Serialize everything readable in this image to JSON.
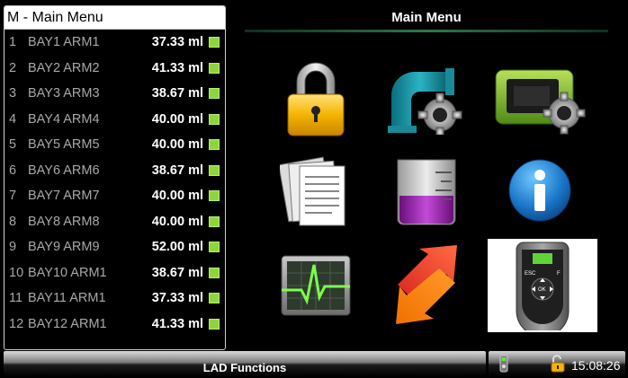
{
  "left_panel": {
    "title": "M - Main Menu",
    "status_color": "#8ed53b",
    "bays": [
      {
        "index": "1",
        "name": "BAY1 ARM1",
        "volume": "37.33 ml"
      },
      {
        "index": "2",
        "name": "BAY2 ARM2",
        "volume": "41.33 ml"
      },
      {
        "index": "3",
        "name": "BAY3 ARM3",
        "volume": "38.67 ml"
      },
      {
        "index": "4",
        "name": "BAY4 ARM4",
        "volume": "40.00 ml"
      },
      {
        "index": "5",
        "name": "BAY5 ARM5",
        "volume": "40.00 ml"
      },
      {
        "index": "6",
        "name": "BAY6 ARM6",
        "volume": "38.67 ml"
      },
      {
        "index": "7",
        "name": "BAY7 ARM7",
        "volume": "40.00 ml"
      },
      {
        "index": "8",
        "name": "BAY8 ARM8",
        "volume": "40.00 ml"
      },
      {
        "index": "9",
        "name": "BAY9 ARM9",
        "volume": "52.00 ml"
      },
      {
        "index": "10",
        "name": "BAY10 ARM1",
        "volume": "38.67 ml"
      },
      {
        "index": "11",
        "name": "BAY11 ARM1",
        "volume": "37.33 ml"
      },
      {
        "index": "12",
        "name": "BAY12 ARM1",
        "volume": "41.33 ml"
      }
    ]
  },
  "main": {
    "title": "Main Menu",
    "tiles": [
      {
        "icon": "padlock-icon"
      },
      {
        "icon": "pipe-settings-icon"
      },
      {
        "icon": "device-settings-icon"
      },
      {
        "icon": "documents-icon"
      },
      {
        "icon": "beaker-icon"
      },
      {
        "icon": "info-icon"
      },
      {
        "icon": "monitor-graph-icon"
      },
      {
        "icon": "transfer-arrows-icon"
      },
      {
        "icon": "handheld-remote-icon",
        "selected": true
      }
    ]
  },
  "bottom_bar": {
    "label": "LAD Functions"
  },
  "status_bar": {
    "time": "15:08:26",
    "icons": [
      "remote-signal-icon",
      "unlocked-padlock-icon"
    ]
  }
}
